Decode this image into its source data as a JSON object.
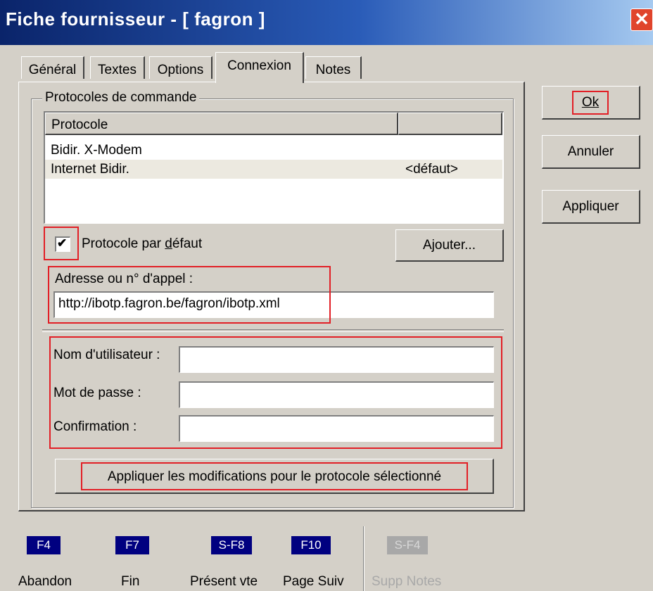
{
  "window": {
    "title": "Fiche fournisseur - [ fagron ]",
    "close_glyph": "✕"
  },
  "tabs": [
    {
      "label": "Général",
      "active": false
    },
    {
      "label": "Textes",
      "active": false
    },
    {
      "label": "Options",
      "active": false
    },
    {
      "label": "Connexion",
      "active": true
    },
    {
      "label": "Notes",
      "active": false
    }
  ],
  "protocols": {
    "group_label": "Protocoles de commande",
    "columns": [
      "Protocole",
      ""
    ],
    "rows": [
      {
        "name": "Bidir. X-Modem",
        "default": ""
      },
      {
        "name": "Internet Bidir.",
        "default": "<défaut>"
      }
    ],
    "default_checkbox": {
      "label": "Protocole par défaut",
      "checked": true,
      "check_glyph": "✔"
    },
    "add_button": "Ajouter...",
    "address_label": "Adresse ou n° d'appel :",
    "address_value": "http://ibotp.fagron.be/fagron/ibotp.xml",
    "username_label": "Nom d'utilisateur :",
    "username_value": "",
    "password_label": "Mot de passe :",
    "password_value": "",
    "confirm_label": "Confirmation :",
    "confirm_value": "",
    "apply_protocol_button": "Appliquer les modifications pour le protocole sélectionné"
  },
  "dialog_buttons": {
    "ok": "Ok",
    "cancel": "Annuler",
    "apply": "Appliquer"
  },
  "function_keys": [
    {
      "key": "F4",
      "label": "Abandon",
      "enabled": true
    },
    {
      "key": "F7",
      "label": "Fin",
      "enabled": true
    },
    {
      "key": "S-F8",
      "label": "Présent vte",
      "enabled": true
    },
    {
      "key": "F10",
      "label": "Page Suiv",
      "enabled": true
    },
    {
      "key": "S-F4",
      "label": "Supp Notes",
      "enabled": false
    }
  ],
  "colors": {
    "highlight": "#e21f26",
    "titlebar": "#0a246a",
    "fkey": "#000080"
  }
}
